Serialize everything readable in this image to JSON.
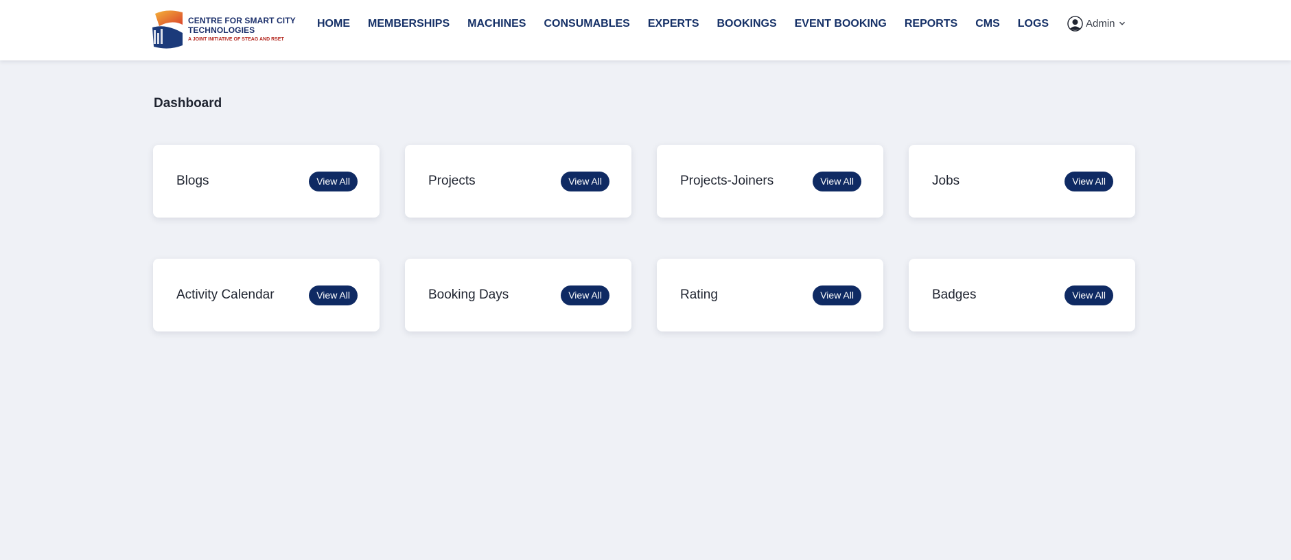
{
  "brand": {
    "line1": "CENTRE FOR SMART CITY",
    "line2": "TECHNOLOGIES",
    "tagline": "A JOINT INITIATIVE OF STEAG AND RSET"
  },
  "nav": {
    "items": [
      {
        "label": "HOME"
      },
      {
        "label": "MEMBERSHIPS"
      },
      {
        "label": "MACHINES"
      },
      {
        "label": "CONSUMABLES"
      },
      {
        "label": "EXPERTS"
      },
      {
        "label": "BOOKINGS"
      },
      {
        "label": "EVENT BOOKING"
      },
      {
        "label": "REPORTS"
      },
      {
        "label": "CMS"
      },
      {
        "label": "LOGS"
      }
    ]
  },
  "user": {
    "name": "Admin",
    "avatar_icon": "user-avatar-icon",
    "menu_icon": "chevron-down-icon"
  },
  "page": {
    "title": "Dashboard"
  },
  "cards": [
    {
      "label": "Blogs",
      "button": "View All"
    },
    {
      "label": "Projects",
      "button": "View All"
    },
    {
      "label": "Projects-Joiners",
      "button": "View All"
    },
    {
      "label": "Jobs",
      "button": "View All"
    },
    {
      "label": "Activity Calendar",
      "button": "View All"
    },
    {
      "label": "Booking Days",
      "button": "View All"
    },
    {
      "label": "Rating",
      "button": "View All"
    },
    {
      "label": "Badges",
      "button": "View All"
    }
  ],
  "colors": {
    "nav_text": "#142f66",
    "button_bg": "#0f2a63",
    "page_bg": "#eff1f6",
    "brand_red": "#b3261e"
  }
}
